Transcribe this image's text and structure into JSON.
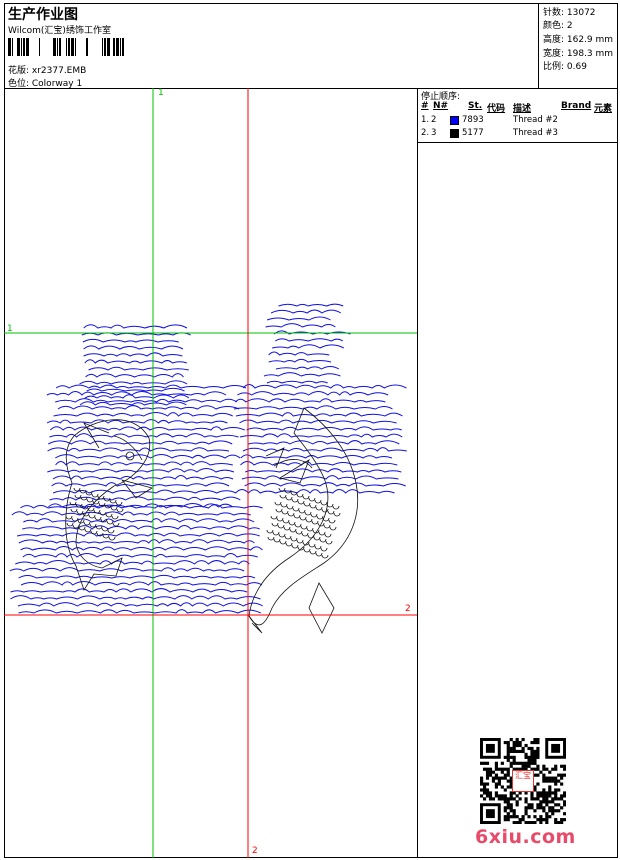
{
  "header": {
    "title": "生产作业图",
    "studio": "Wilcom(汇宝)绣饰工作室",
    "design": "花版: xr2377.EMB",
    "colorway": "色位: Colorway 1"
  },
  "stats": [
    "针数: 13072",
    "颜色: 2",
    "高度: 162.9 mm",
    "宽度: 198.3 mm",
    "比例: 0.69"
  ],
  "stops": {
    "title": "停止顺序:",
    "columns": [
      "#",
      "N#",
      "St.",
      "代码",
      "描述",
      "Brand",
      "元素"
    ],
    "rows": [
      {
        "index": "1.",
        "needle": "2",
        "color": "#0000ff",
        "code": "7893",
        "desc": "Thread #2"
      },
      {
        "index": "2.",
        "needle": "3",
        "color": "#000000",
        "code": "5177",
        "desc": "Thread #3"
      }
    ]
  },
  "guides": {
    "green_label": "1",
    "red_label": "2",
    "green_color": "#00c000",
    "red_color": "#ff0000"
  },
  "watermark": {
    "site": "6xiu.com",
    "seal": "汇宝"
  }
}
